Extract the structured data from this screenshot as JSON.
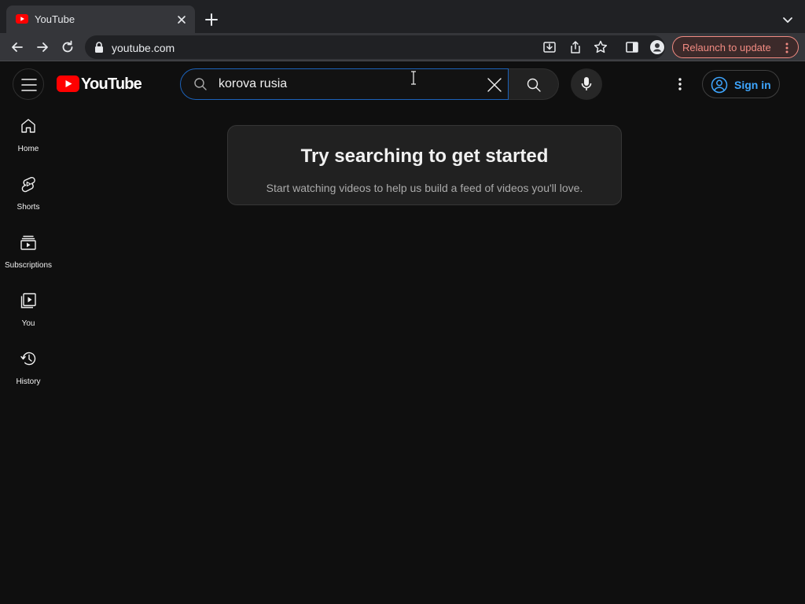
{
  "browser": {
    "tab_title": "YouTube",
    "url": "youtube.com",
    "relaunch_label": "Relaunch to update"
  },
  "masthead": {
    "logo_text": "YouTube",
    "search_value": "korova rusia",
    "signin_label": "Sign in"
  },
  "guide": {
    "items": [
      {
        "label": "Home",
        "icon": "home-icon"
      },
      {
        "label": "Shorts",
        "icon": "shorts-icon"
      },
      {
        "label": "Subscriptions",
        "icon": "subscriptions-icon"
      },
      {
        "label": "You",
        "icon": "you-icon"
      },
      {
        "label": "History",
        "icon": "history-icon"
      }
    ]
  },
  "main": {
    "card_title": "Try searching to get started",
    "card_subtitle": "Start watching videos to help us build a feed of videos you'll love."
  },
  "colors": {
    "background": "#0f0f0f",
    "brand_red": "#ff0000",
    "link_blue": "#3ea6ff",
    "search_focus_border": "#1c62b9",
    "relaunch_accent": "#f28b82"
  }
}
